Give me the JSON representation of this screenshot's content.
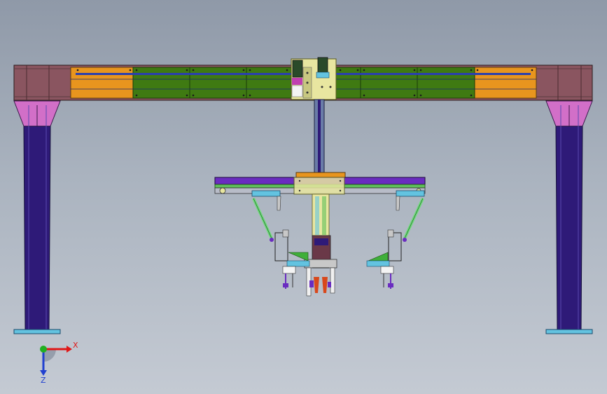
{
  "viewport": {
    "background_top": "#8f99a8",
    "background_bottom": "#c4cad3"
  },
  "colors": {
    "frame_brown": "#8a5560",
    "column_navy": "#2e1a78",
    "column_cap": "#d26fc8",
    "orange_panel": "#e8951e",
    "green_panel": "#3f7a12",
    "blue_stripe": "#2a3fb0",
    "carriage_yellow": "#e8e6a0",
    "cyan_plate": "#63c3e0",
    "lime_arm": "#6edc7a",
    "purple_arm": "#6a2cc0",
    "red_gripper": "#d8481c",
    "axis_x": "#e01818",
    "axis_y": "#20b020",
    "axis_z": "#2040d0"
  },
  "triad": {
    "x_label": "X",
    "z_label": "Z"
  }
}
